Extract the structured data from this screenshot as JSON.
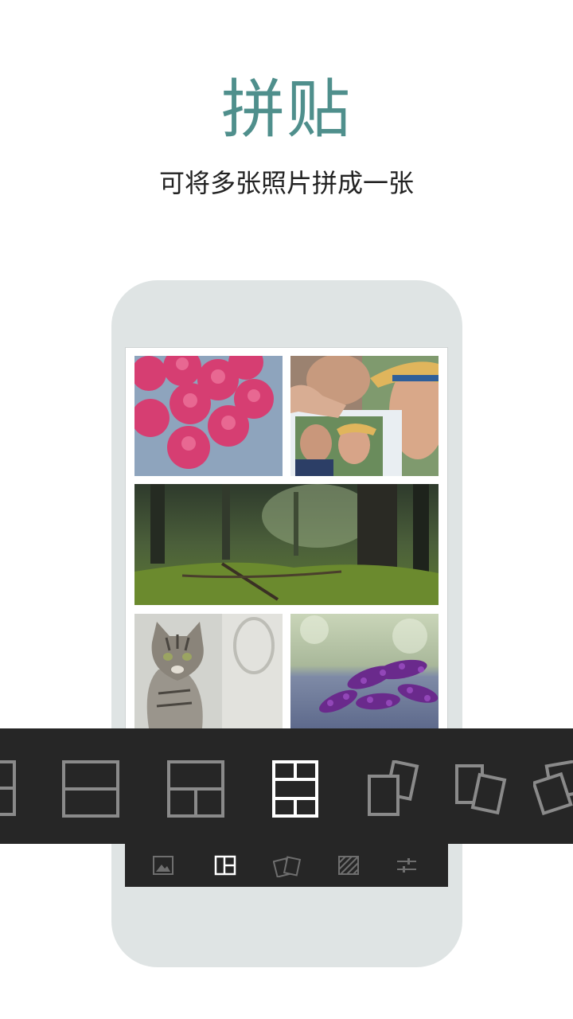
{
  "header": {
    "title": "拼贴",
    "subtitle": "可将多张照片拼成一张"
  },
  "collage": {
    "photos": [
      {
        "name": "raspberry-candies-photo"
      },
      {
        "name": "selfie-couple-photo"
      },
      {
        "name": "forest-photo"
      },
      {
        "name": "cat-photo"
      },
      {
        "name": "lavender-photo"
      }
    ]
  },
  "layout_picker": {
    "selected": "layout-grid-5",
    "options": [
      {
        "icon": "layout-partial-icon"
      },
      {
        "icon": "layout-two-rows-icon"
      },
      {
        "icon": "layout-top-two-bottom-icon"
      },
      {
        "icon": "layout-grid-5-icon",
        "selected": true
      },
      {
        "icon": "layout-tilted-pair-icon"
      },
      {
        "icon": "layout-tilted-pair-alt-icon"
      },
      {
        "icon": "layout-tilted-partial-icon"
      }
    ]
  },
  "bottom_toolbar": {
    "items": [
      {
        "icon": "image-icon"
      },
      {
        "icon": "layout-icon",
        "active": true
      },
      {
        "icon": "freestyle-icon"
      },
      {
        "icon": "background-pattern-icon"
      },
      {
        "icon": "adjust-icon"
      }
    ]
  },
  "colors": {
    "accent": "#4f8f8c",
    "phone_frame": "#dfe4e4",
    "toolbar_bg": "#262626",
    "icon_inactive": "#8a8a8a",
    "icon_active": "#ffffff"
  }
}
